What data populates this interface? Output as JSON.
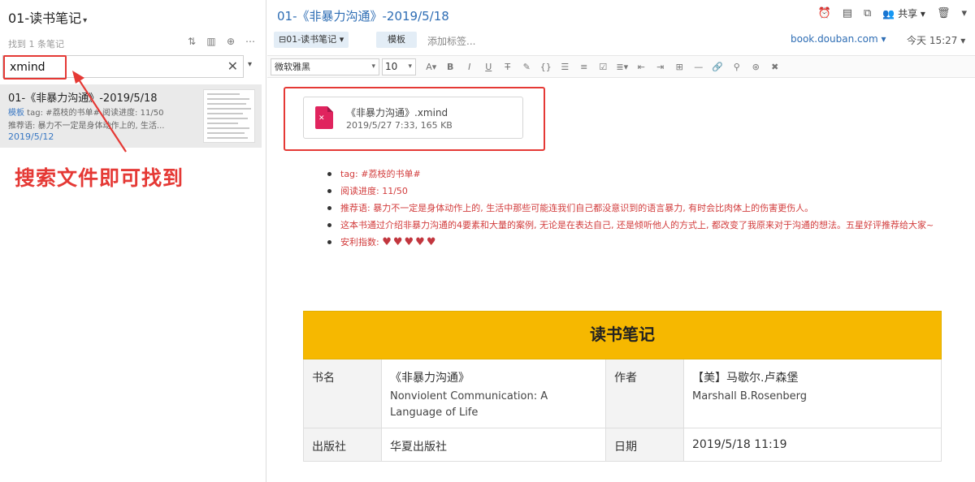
{
  "left_pane": {
    "notebook_title": "01-读书笔记",
    "found_count": "找到 1 条笔记",
    "tool_icons": [
      "sort-icon",
      "view-icon",
      "lock-icon",
      "more-icon"
    ],
    "search": {
      "value": "xmind",
      "clear_glyph": "✕",
      "dropdown_glyph": "▾"
    },
    "note_item": {
      "title": "01-《非暴力沟通》-2019/5/18",
      "line1_tag": "模板",
      "line1_text": " tag: #荔枝的书单# 阅读进度: 11/50",
      "line2_text": "推荐语: 暴力不一定是身体动作上的, 生活...",
      "date": "2019/5/12"
    },
    "annotation": "搜索文件即可找到"
  },
  "right_pane": {
    "note_title": "01-《非暴力沟通》-2019/5/18",
    "share_label": "共享",
    "notebook_chip": "01-读书笔记",
    "template_chip": "模板",
    "add_tag_placeholder": "添加标签...",
    "source_url": "book.douban.com",
    "timestamp": "今天 15:27",
    "toolbar": {
      "font": "微软雅黑",
      "size": "10",
      "icons": [
        "font-color-icon",
        "bold-icon",
        "italic-icon",
        "underline-icon",
        "strikethrough-icon",
        "highlight-icon",
        "code-icon",
        "bullet-list-icon",
        "numbered-list-icon",
        "checkbox-icon",
        "align-icon",
        "indent-decrease-icon",
        "indent-increase-icon",
        "table-icon",
        "hr-icon",
        "link-icon",
        "unlink-icon",
        "location-icon",
        "clear-format-icon"
      ]
    },
    "attachment": {
      "icon_label": "✕",
      "name": "《非暴力沟通》.xmind",
      "meta": "2019/5/27 7:33, 165 KB"
    },
    "bullets": [
      "tag: #荔枝的书单#",
      "阅读进度: 11/50",
      "推荐语: 暴力不一定是身体动作上的, 生活中那些可能连我们自己都没意识到的语言暴力, 有时会比肉体上的伤害更伤人。",
      "这本书通过介绍非暴力沟通的4要素和大量的案例, 无论是在表达自己, 还是倾听他人的方式上, 都改变了我原来对于沟通的想法。五星好评推荐给大家~",
      "安利指数:"
    ],
    "hearts": "♥♥♥♥♥",
    "table": {
      "title": "读书笔记",
      "rows": [
        {
          "k1": "书名",
          "v1": "《非暴力沟通》",
          "v1_sub": "Nonviolent Communication: A Language of Life",
          "k2": "作者",
          "v2": "【美】马歇尔.卢森堡",
          "v2_sub": "Marshall B.Rosenberg"
        },
        {
          "k1": "出版社",
          "v1": "华夏出版社",
          "v1_sub": "",
          "k2": "日期",
          "v2": "2019/5/18 11:19",
          "v2_sub": ""
        }
      ]
    }
  }
}
